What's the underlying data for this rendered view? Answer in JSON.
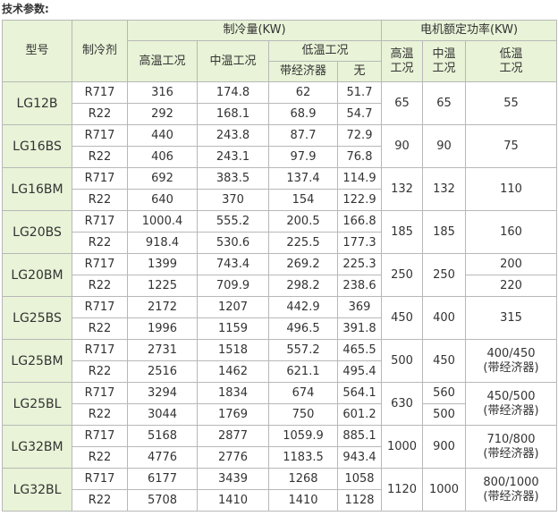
{
  "title": "技术参数:",
  "headers": {
    "model": "型号",
    "refrigerant": "制冷剂",
    "capacity": "制冷量(KW)",
    "power": "电机额定功率(KW)",
    "high_temp": "高温工况",
    "mid_temp": "中温工况",
    "low_temp": "低温工况",
    "with_economizer": "带经济器",
    "without": "无",
    "p_high": "高温工况",
    "p_mid": "中温工况",
    "p_low": "低温工况"
  },
  "rows": [
    {
      "model": "LG12B",
      "power_high": "65",
      "power_mid": "65",
      "power_low": [
        "55"
      ],
      "lines": [
        {
          "refrigerant": "R717",
          "high": "316",
          "mid": "174.8",
          "low_econ": "62",
          "low_none": "51.7"
        },
        {
          "refrigerant": "R22",
          "high": "292",
          "mid": "168.1",
          "low_econ": "68.9",
          "low_none": "54.7"
        }
      ]
    },
    {
      "model": "LG16BS",
      "power_high": "90",
      "power_mid": "90",
      "power_low": [
        "75"
      ],
      "lines": [
        {
          "refrigerant": "R717",
          "high": "440",
          "mid": "243.8",
          "low_econ": "87.7",
          "low_none": "72.9"
        },
        {
          "refrigerant": "R22",
          "high": "406",
          "mid": "243.1",
          "low_econ": "97.9",
          "low_none": "76.8"
        }
      ]
    },
    {
      "model": "LG16BM",
      "power_high": "132",
      "power_mid": "132",
      "power_low": [
        "110"
      ],
      "lines": [
        {
          "refrigerant": "R717",
          "high": "692",
          "mid": "383.5",
          "low_econ": "137.4",
          "low_none": "114.9"
        },
        {
          "refrigerant": "R22",
          "high": "640",
          "mid": "370",
          "low_econ": "154",
          "low_none": "122.9"
        }
      ]
    },
    {
      "model": "LG20BS",
      "power_high": "185",
      "power_mid": "185",
      "power_low": [
        "160"
      ],
      "lines": [
        {
          "refrigerant": "R717",
          "high": "1000.4",
          "mid": "555.2",
          "low_econ": "200.5",
          "low_none": "166.8"
        },
        {
          "refrigerant": "R22",
          "high": "918.4",
          "mid": "530.6",
          "low_econ": "225.5",
          "low_none": "177.3"
        }
      ]
    },
    {
      "model": "LG20BM",
      "power_high": "250",
      "power_mid": "250",
      "power_low": [
        "200",
        "220"
      ],
      "lines": [
        {
          "refrigerant": "R717",
          "high": "1399",
          "mid": "743.4",
          "low_econ": "269.2",
          "low_none": "225.3"
        },
        {
          "refrigerant": "R22",
          "high": "1225",
          "mid": "709.9",
          "low_econ": "298.2",
          "low_none": "238.6"
        }
      ]
    },
    {
      "model": "LG25BS",
      "power_high": "450",
      "power_mid": "400",
      "power_low": [
        "315"
      ],
      "lines": [
        {
          "refrigerant": "R717",
          "high": "2172",
          "mid": "1207",
          "low_econ": "442.9",
          "low_none": "369"
        },
        {
          "refrigerant": "R22",
          "high": "1996",
          "mid": "1159",
          "low_econ": "496.5",
          "low_none": "391.8"
        }
      ]
    },
    {
      "model": "LG25BM",
      "power_high": "500",
      "power_mid": "450",
      "power_low": [
        "400/450",
        "(带经济器)"
      ],
      "lines": [
        {
          "refrigerant": "R717",
          "high": "2731",
          "mid": "1518",
          "low_econ": "557.2",
          "low_none": "465.5"
        },
        {
          "refrigerant": "R22",
          "high": "2516",
          "mid": "1462",
          "low_econ": "621.1",
          "low_none": "495.4"
        }
      ]
    },
    {
      "model": "LG25BL",
      "power_high": "630",
      "power_mid": [
        "560",
        "500"
      ],
      "power_low": [
        "450/500",
        "(带经济器)"
      ],
      "lines": [
        {
          "refrigerant": "R717",
          "high": "3294",
          "mid": "1834",
          "low_econ": "674",
          "low_none": "564.1"
        },
        {
          "refrigerant": "R22",
          "high": "3044",
          "mid": "1769",
          "low_econ": "750",
          "low_none": "601.2"
        }
      ]
    },
    {
      "model": "LG32BM",
      "power_high": "1000",
      "power_mid": "900",
      "power_low": [
        "710/800",
        "(带经济器)"
      ],
      "lines": [
        {
          "refrigerant": "R717",
          "high": "5168",
          "mid": "2877",
          "low_econ": "1059.9",
          "low_none": "885.1"
        },
        {
          "refrigerant": "R22",
          "high": "4776",
          "mid": "2776",
          "low_econ": "1183.5",
          "low_none": "943.4"
        }
      ]
    },
    {
      "model": "LG32BL",
      "power_high": "1120",
      "power_mid": "1000",
      "power_low": [
        "800/1000",
        "(带经济器)"
      ],
      "lines": [
        {
          "refrigerant": "R717",
          "high": "6177",
          "mid": "3439",
          "low_econ": "1268",
          "low_none": "1058"
        },
        {
          "refrigerant": "R22",
          "high": "5708",
          "mid": "1410",
          "low_econ": "1410",
          "low_none": "1128"
        }
      ]
    }
  ],
  "colors": {
    "header_bg": "#e8f3d7",
    "border": "#b8b8b8",
    "text": "#333333"
  }
}
